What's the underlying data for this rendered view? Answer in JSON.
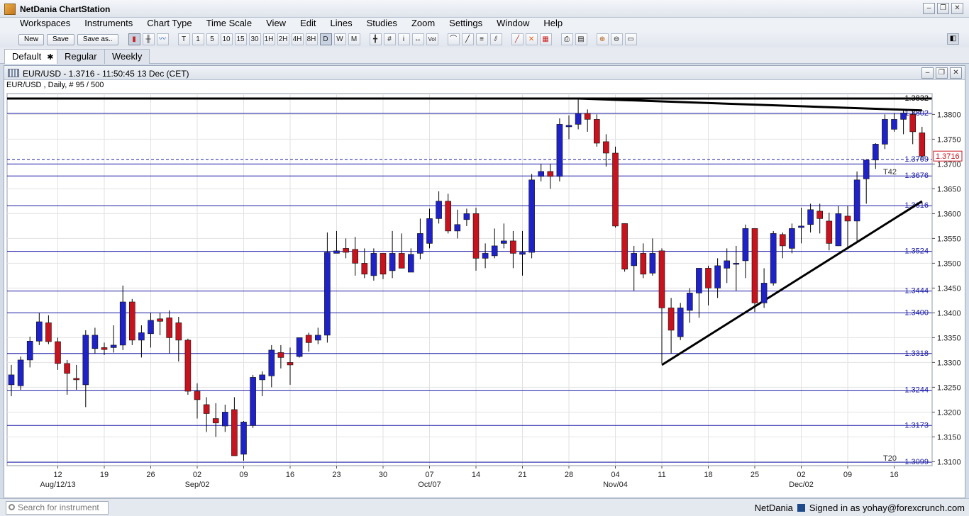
{
  "app": {
    "title": "NetDania ChartStation"
  },
  "window_buttons": {
    "minimize": "–",
    "restore": "❐",
    "close": "✕"
  },
  "menu": [
    "Workspaces",
    "Instruments",
    "Chart Type",
    "Time Scale",
    "View",
    "Edit",
    "Lines",
    "Studies",
    "Zoom",
    "Settings",
    "Window",
    "Help"
  ],
  "toolbar": {
    "new_label": "New",
    "save_label": "Save",
    "save_as_label": "Save as..",
    "chart_type_icons": [
      "candles-icon",
      "bars-icon",
      "line-icon"
    ],
    "timescales": [
      "T",
      "1",
      "5",
      "10",
      "15",
      "30",
      "1H",
      "2H",
      "4H",
      "8H",
      "D",
      "W",
      "M"
    ],
    "selected_timescale": "D",
    "tool_icons": [
      "crosshair-icon",
      "grid-icon",
      "info-icon",
      "scroll-icon",
      "volume-icon",
      "draw-icon",
      "trendline-icon",
      "fib-icon",
      "channel-icon",
      "delete-line-icon",
      "delete-all-icon",
      "studies-icon",
      "print-icon",
      "preview-icon",
      "zoom-in-icon",
      "zoom-out-icon",
      "zoom-reset-icon"
    ]
  },
  "tabs": [
    {
      "label": "Default",
      "active": true
    },
    {
      "label": "Regular",
      "active": false
    },
    {
      "label": "Weekly",
      "active": false
    }
  ],
  "chart_window": {
    "title": "EUR/USD - 1.3716 - 11:50:45  13 Dec (CET)",
    "subtitle": "EUR/USD , Daily, # 95 / 500"
  },
  "status": {
    "search_placeholder": "Search for instrument",
    "brand": "NetDania",
    "signed_in": "Signed in as yohay@forexcrunch.com"
  },
  "chart_data": {
    "type": "candlestick",
    "symbol": "EUR/USD",
    "interval": "Daily",
    "ylim": [
      1.3092,
      1.3842
    ],
    "y_ticks": [
      1.31,
      1.315,
      1.32,
      1.325,
      1.33,
      1.335,
      1.34,
      1.345,
      1.35,
      1.355,
      1.36,
      1.365,
      1.37,
      1.375,
      1.38
    ],
    "x_labels": [
      {
        "index": 5,
        "day": "12",
        "month": "Aug/12/13"
      },
      {
        "index": 10,
        "day": "19"
      },
      {
        "index": 15,
        "day": "26"
      },
      {
        "index": 20,
        "day": "02",
        "month": "Sep/02"
      },
      {
        "index": 25,
        "day": "09"
      },
      {
        "index": 30,
        "day": "16"
      },
      {
        "index": 35,
        "day": "23"
      },
      {
        "index": 40,
        "day": "30"
      },
      {
        "index": 45,
        "day": "07",
        "month": "Oct/07"
      },
      {
        "index": 50,
        "day": "14"
      },
      {
        "index": 55,
        "day": "21"
      },
      {
        "index": 60,
        "day": "28"
      },
      {
        "index": 65,
        "day": "04",
        "month": "Nov/04"
      },
      {
        "index": 70,
        "day": "11"
      },
      {
        "index": 75,
        "day": "18"
      },
      {
        "index": 80,
        "day": "25"
      },
      {
        "index": 85,
        "day": "02",
        "month": "Dec/02"
      },
      {
        "index": 90,
        "day": "09"
      },
      {
        "index": 95,
        "day": "16"
      }
    ],
    "candles": [
      [
        1.3255,
        1.3295,
        1.3232,
        1.3275
      ],
      [
        1.3253,
        1.3312,
        1.3245,
        1.3305
      ],
      [
        1.3305,
        1.3352,
        1.329,
        1.3343
      ],
      [
        1.3343,
        1.34,
        1.3335,
        1.3382
      ],
      [
        1.338,
        1.3395,
        1.3337,
        1.3342
      ],
      [
        1.3342,
        1.335,
        1.3285,
        1.3298
      ],
      [
        1.3298,
        1.3305,
        1.3235,
        1.3278
      ],
      [
        1.3268,
        1.3295,
        1.3245,
        1.3265
      ],
      [
        1.3255,
        1.3365,
        1.321,
        1.3355
      ],
      [
        1.3328,
        1.337,
        1.3318,
        1.3355
      ],
      [
        1.333,
        1.334,
        1.3315,
        1.3326
      ],
      [
        1.333,
        1.3375,
        1.332,
        1.3335
      ],
      [
        1.3335,
        1.3455,
        1.3325,
        1.3422
      ],
      [
        1.3422,
        1.3428,
        1.3335,
        1.3345
      ],
      [
        1.3345,
        1.3375,
        1.331,
        1.336
      ],
      [
        1.3358,
        1.34,
        1.333,
        1.3385
      ],
      [
        1.3388,
        1.34,
        1.3355,
        1.3383
      ],
      [
        1.339,
        1.3405,
        1.3318,
        1.335
      ],
      [
        1.338,
        1.3392,
        1.3302,
        1.3345
      ],
      [
        1.3345,
        1.3348,
        1.3235,
        1.3242
      ],
      [
        1.3242,
        1.3258,
        1.3187,
        1.3225
      ],
      [
        1.3215,
        1.323,
        1.316,
        1.3197
      ],
      [
        1.3187,
        1.3218,
        1.315,
        1.3178
      ],
      [
        1.3172,
        1.3215,
        1.316,
        1.32
      ],
      [
        1.3205,
        1.323,
        1.3125,
        1.3112
      ],
      [
        1.3115,
        1.3182,
        1.3102,
        1.318
      ],
      [
        1.3173,
        1.3275,
        1.3168,
        1.327
      ],
      [
        1.3265,
        1.3282,
        1.3232,
        1.3275
      ],
      [
        1.3273,
        1.3335,
        1.325,
        1.3325
      ],
      [
        1.332,
        1.3335,
        1.3288,
        1.331
      ],
      [
        1.33,
        1.333,
        1.3255,
        1.3295
      ],
      [
        1.3312,
        1.3338,
        1.331,
        1.335
      ],
      [
        1.3355,
        1.336,
        1.3322,
        1.334
      ],
      [
        1.3345,
        1.337,
        1.3337,
        1.3355
      ],
      [
        1.3355,
        1.3562,
        1.334,
        1.3522
      ],
      [
        1.352,
        1.3565,
        1.3525,
        1.3525
      ],
      [
        1.353,
        1.355,
        1.351,
        1.3522
      ],
      [
        1.3528,
        1.3553,
        1.3475,
        1.35
      ],
      [
        1.35,
        1.353,
        1.347,
        1.3478
      ],
      [
        1.3475,
        1.353,
        1.3465,
        1.352
      ],
      [
        1.352,
        1.352,
        1.3468,
        1.3478
      ],
      [
        1.3485,
        1.3565,
        1.347,
        1.352
      ],
      [
        1.352,
        1.356,
        1.349,
        1.349
      ],
      [
        1.3482,
        1.353,
        1.3482,
        1.3518
      ],
      [
        1.352,
        1.359,
        1.3508,
        1.356
      ],
      [
        1.354,
        1.361,
        1.353,
        1.359
      ],
      [
        1.359,
        1.3645,
        1.358,
        1.3625
      ],
      [
        1.3625,
        1.364,
        1.356,
        1.3565
      ],
      [
        1.3565,
        1.3608,
        1.355,
        1.3578
      ],
      [
        1.3588,
        1.361,
        1.3575,
        1.36
      ],
      [
        1.36,
        1.3612,
        1.3485,
        1.351
      ],
      [
        1.351,
        1.354,
        1.349,
        1.352
      ],
      [
        1.3515,
        1.357,
        1.351,
        1.3535
      ],
      [
        1.354,
        1.358,
        1.353,
        1.3545
      ],
      [
        1.3545,
        1.3565,
        1.349,
        1.352
      ],
      [
        1.3518,
        1.3565,
        1.3475,
        1.3522
      ],
      [
        1.3522,
        1.368,
        1.351,
        1.3668
      ],
      [
        1.3675,
        1.37,
        1.3665,
        1.3685
      ],
      [
        1.3685,
        1.37,
        1.365,
        1.3675
      ],
      [
        1.3675,
        1.3792,
        1.3665,
        1.378
      ],
      [
        1.3775,
        1.3798,
        1.375,
        1.3778
      ],
      [
        1.378,
        1.383,
        1.377,
        1.3802
      ],
      [
        1.3802,
        1.381,
        1.3765,
        1.379
      ],
      [
        1.379,
        1.38,
        1.3735,
        1.3742
      ],
      [
        1.3745,
        1.376,
        1.3695,
        1.3722
      ],
      [
        1.3722,
        1.3735,
        1.3572,
        1.3575
      ],
      [
        1.358,
        1.358,
        1.3483,
        1.3488
      ],
      [
        1.3495,
        1.3535,
        1.3445,
        1.352
      ],
      [
        1.352,
        1.354,
        1.347,
        1.3478
      ],
      [
        1.348,
        1.355,
        1.3475,
        1.352
      ],
      [
        1.3525,
        1.353,
        1.3298,
        1.341
      ],
      [
        1.341,
        1.343,
        1.3318,
        1.3365
      ],
      [
        1.3352,
        1.342,
        1.3345,
        1.341
      ],
      [
        1.3405,
        1.345,
        1.338,
        1.344
      ],
      [
        1.344,
        1.349,
        1.339,
        1.349
      ],
      [
        1.349,
        1.3495,
        1.3415,
        1.345
      ],
      [
        1.345,
        1.351,
        1.343,
        1.3495
      ],
      [
        1.349,
        1.353,
        1.346,
        1.3505
      ],
      [
        1.35,
        1.3535,
        1.3445,
        1.35
      ],
      [
        1.3505,
        1.3578,
        1.347,
        1.357
      ],
      [
        1.357,
        1.3568,
        1.3402,
        1.342
      ],
      [
        1.342,
        1.349,
        1.341,
        1.346
      ],
      [
        1.346,
        1.3565,
        1.3455,
        1.356
      ],
      [
        1.3558,
        1.3562,
        1.351,
        1.3535
      ],
      [
        1.353,
        1.358,
        1.352,
        1.357
      ],
      [
        1.3572,
        1.3612,
        1.354,
        1.3575
      ],
      [
        1.3578,
        1.362,
        1.3562,
        1.3608
      ],
      [
        1.3605,
        1.362,
        1.356,
        1.359
      ],
      [
        1.3585,
        1.3602,
        1.3526,
        1.354
      ],
      [
        1.3535,
        1.3615,
        1.3535,
        1.36
      ],
      [
        1.3595,
        1.3615,
        1.353,
        1.3585
      ],
      [
        1.3585,
        1.3685,
        1.3545,
        1.3668
      ],
      [
        1.367,
        1.369,
        1.362,
        1.3708
      ],
      [
        1.3708,
        1.3742,
        1.369,
        1.374
      ],
      [
        1.374,
        1.38,
        1.373,
        1.379
      ],
      [
        1.377,
        1.3802,
        1.3765,
        1.379
      ],
      [
        1.379,
        1.3808,
        1.376,
        1.3803
      ],
      [
        1.38,
        1.381,
        1.374,
        1.3765
      ],
      [
        1.3763,
        1.3775,
        1.371,
        1.3716
      ]
    ],
    "horizontal_lines": [
      {
        "value": 1.3832,
        "label": "1.3832",
        "style": "thick",
        "color": "#000000"
      },
      {
        "value": 1.3802,
        "label": "1.3802",
        "style": "solid",
        "color": "#1a1aa6"
      },
      {
        "value": 1.3709,
        "label": "1.3709",
        "style": "dashed",
        "color": "#1a1aa6"
      },
      {
        "value": 1.37,
        "label": "",
        "style": "solid",
        "color": "#1a1aa6"
      },
      {
        "value": 1.3676,
        "label": "1.3676",
        "style": "solid",
        "color": "#1a1aa6",
        "tag": "T42"
      },
      {
        "value": 1.3616,
        "label": "1.3616",
        "style": "solid",
        "color": "#1a1aa6"
      },
      {
        "value": 1.3524,
        "label": "1.3524",
        "style": "solid",
        "color": "#1a1aa6"
      },
      {
        "value": 1.3444,
        "label": "1.3444",
        "style": "solid",
        "color": "#1a1aa6"
      },
      {
        "value": 1.34,
        "label": "1.3400",
        "style": "solid",
        "color": "#1a1aa6"
      },
      {
        "value": 1.3318,
        "label": "1.3318",
        "style": "solid",
        "color": "#1a1aa6"
      },
      {
        "value": 1.3244,
        "label": "1.3244",
        "style": "solid",
        "color": "#1a1aa6"
      },
      {
        "value": 1.3173,
        "label": "1.3173",
        "style": "solid",
        "color": "#1a1aa6"
      },
      {
        "value": 1.3099,
        "label": "1.3099",
        "style": "solid",
        "color": "#1a1aa6",
        "tag": "T20"
      }
    ],
    "trendlines": [
      {
        "from": [
          61,
          1.3832
        ],
        "to": [
          98,
          1.3808
        ]
      },
      {
        "from": [
          70,
          1.3295
        ],
        "to": [
          98,
          1.3625
        ]
      }
    ],
    "current_price": {
      "value": 1.3716,
      "label": "1.3716"
    },
    "colors": {
      "up": "#1e22c8",
      "down": "#c8121e",
      "grid": "#e2e2e2"
    }
  }
}
